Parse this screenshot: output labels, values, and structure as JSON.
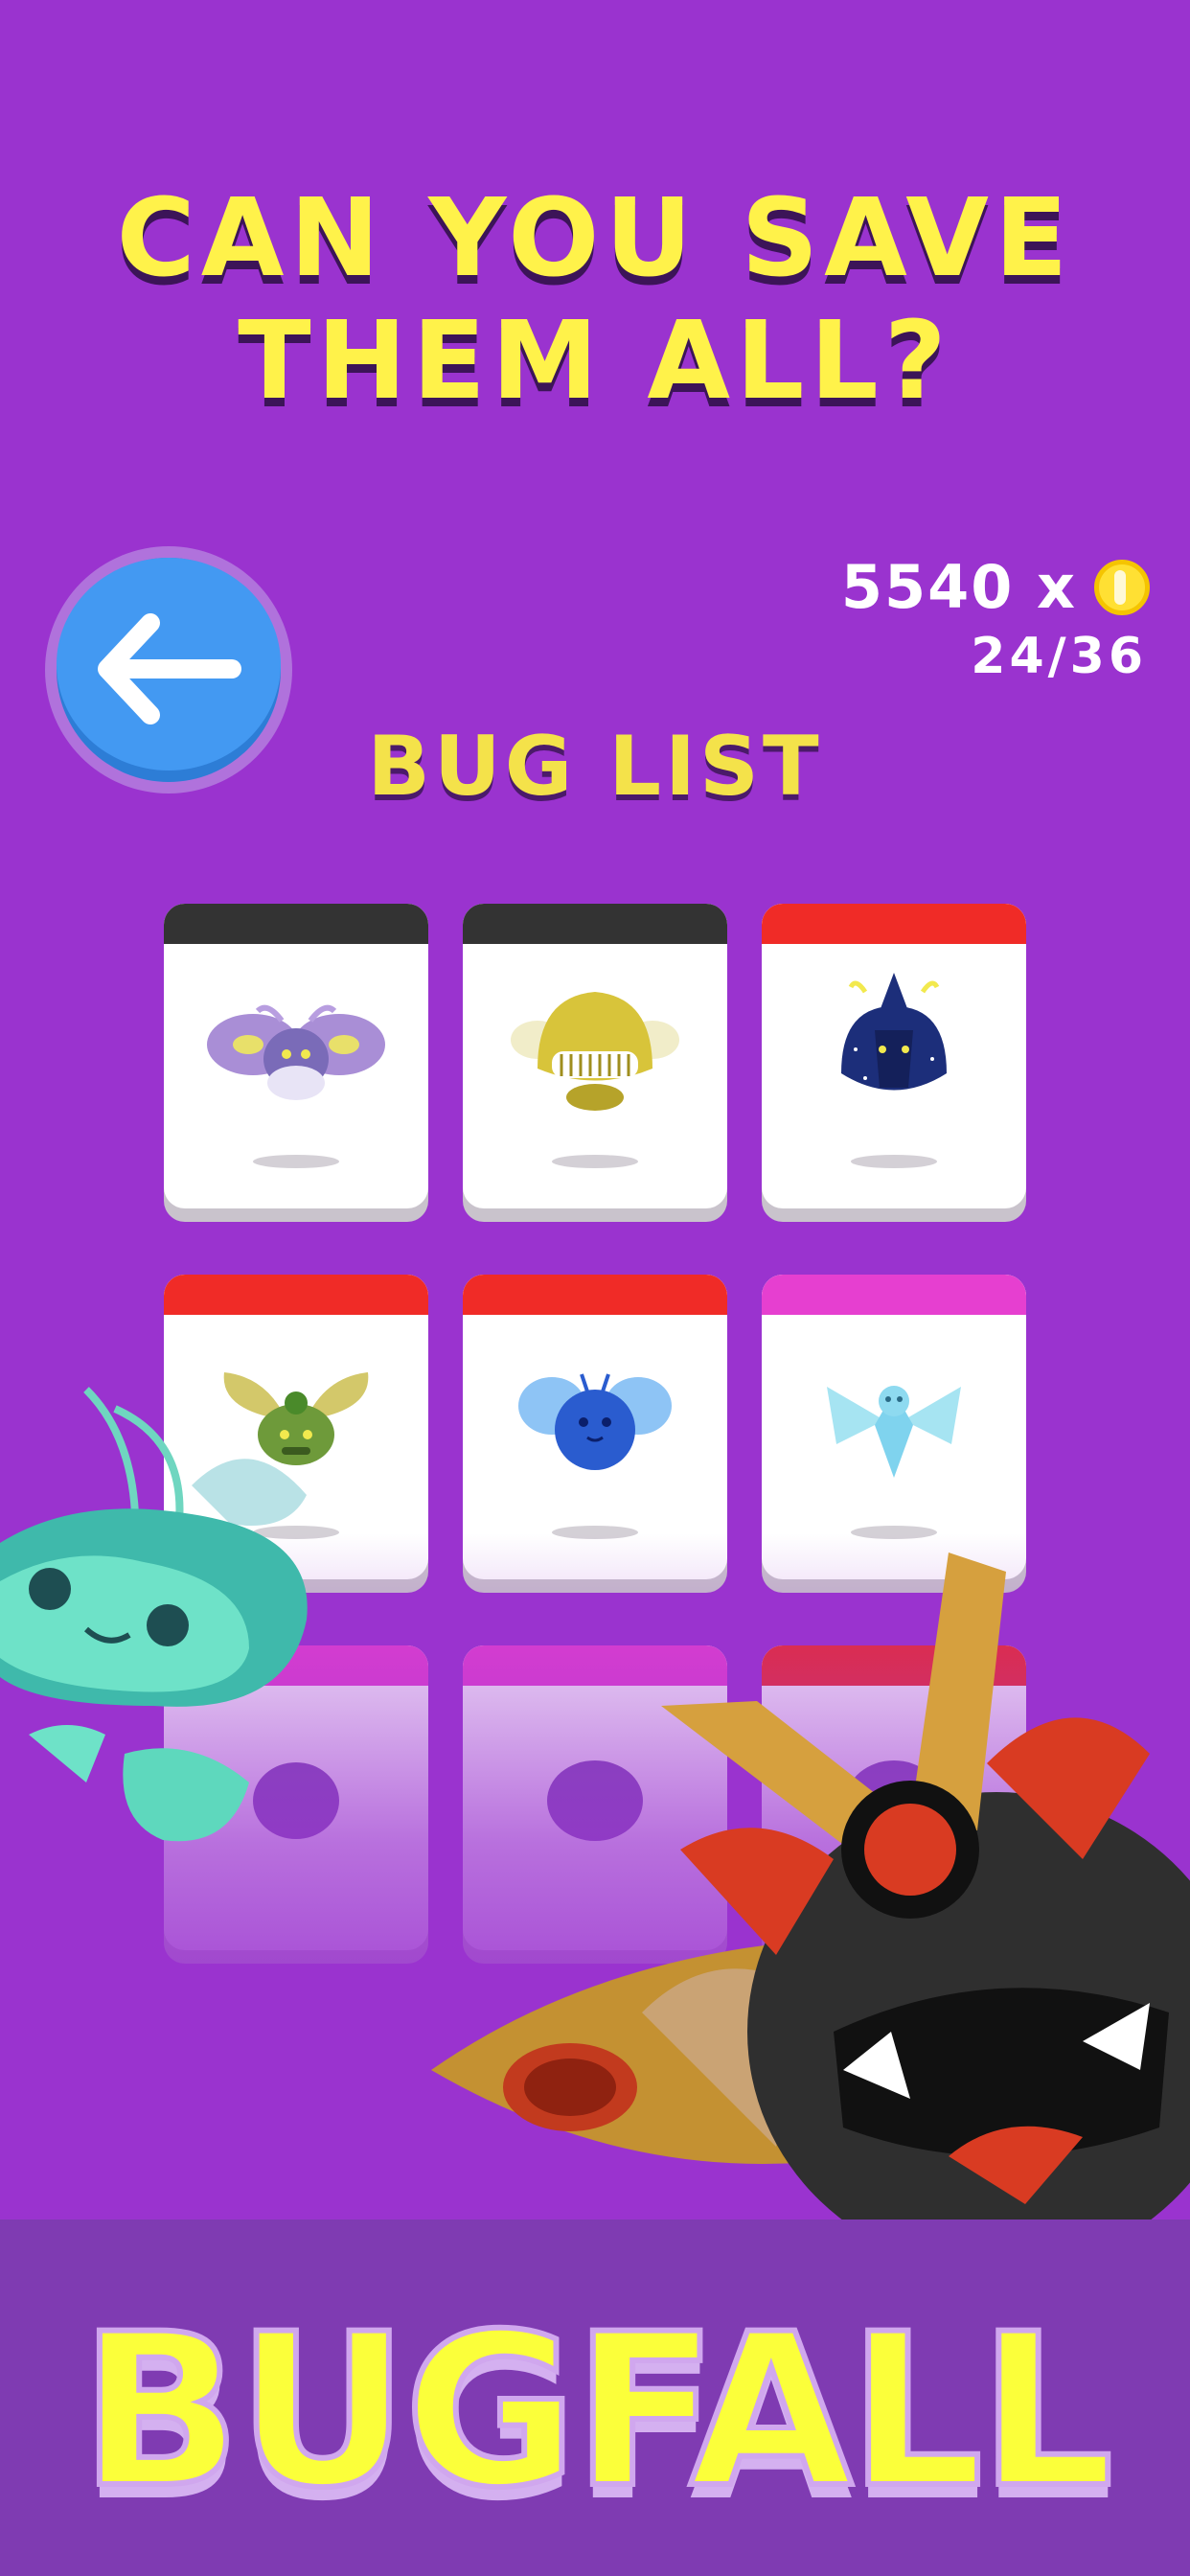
{
  "headline": {
    "line1": "CAN YOU SAVE",
    "line2": "THEM ALL?"
  },
  "back_button": {
    "icon": "arrow-left-icon"
  },
  "stats": {
    "coins": "5540 x",
    "coin_icon": "coin-icon",
    "progress": "24/36"
  },
  "section": {
    "title": "BUG LIST"
  },
  "footer": {
    "logo": "BUGFALL"
  },
  "colors": {
    "background": "#9a33cf",
    "headline": "#fff24a",
    "band_dark": "#333333",
    "band_red": "#f02b27",
    "band_pink": "#e63fd0"
  },
  "bug_list": [
    {
      "name": "moth-bug",
      "band": "dark"
    },
    {
      "name": "gold-beetle-bug",
      "band": "dark"
    },
    {
      "name": "night-beetle-bug",
      "band": "red"
    },
    {
      "name": "leaf-beetle-bug",
      "band": "red"
    },
    {
      "name": "blue-fuzz-bug",
      "band": "red"
    },
    {
      "name": "crystal-fly-bug",
      "band": "pink"
    },
    {
      "name": "locked-bug-7",
      "band": "pink"
    },
    {
      "name": "locked-bug-8",
      "band": "pink"
    },
    {
      "name": "locked-bug-9",
      "band": "red"
    }
  ]
}
